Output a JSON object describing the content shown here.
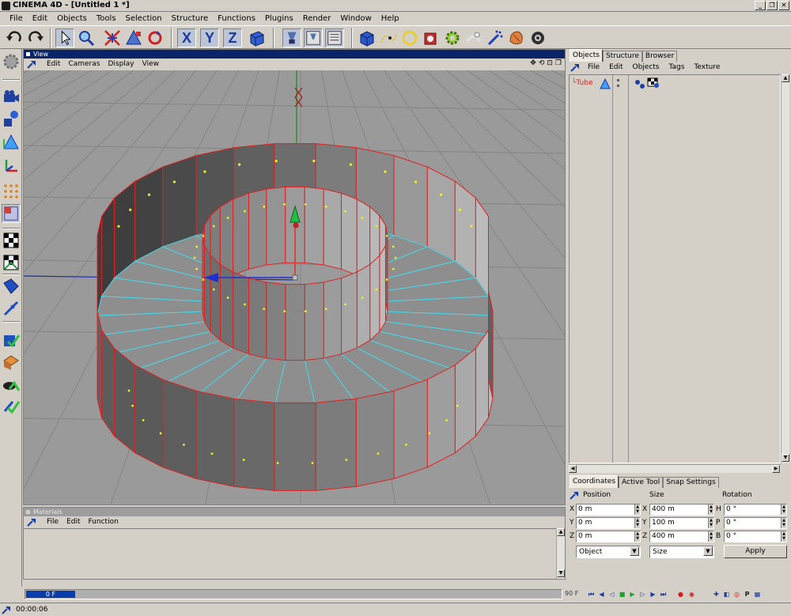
{
  "window": {
    "title": "CINEMA 4D - [Untitled 1 *]"
  },
  "menu": [
    "File",
    "Edit",
    "Objects",
    "Tools",
    "Selection",
    "Structure",
    "Functions",
    "Plugins",
    "Render",
    "Window",
    "Help"
  ],
  "toolbar": {
    "x_axis": "X",
    "y_axis": "Y",
    "z_axis": "Z"
  },
  "view": {
    "title": "View",
    "menu": [
      "Edit",
      "Cameras",
      "Display",
      "View"
    ],
    "nav_glyphs": [
      "✥",
      "⟲",
      "⊡",
      "❐"
    ]
  },
  "materials": {
    "title": "Materials",
    "menu": [
      "File",
      "Edit",
      "Function"
    ]
  },
  "timeline": {
    "current_frame": "0 F",
    "end_frame": "90 F"
  },
  "status": {
    "time": "00:00:06"
  },
  "object_manager": {
    "tabs": [
      "Objects",
      "Structure",
      "Browser"
    ],
    "active_tab": "Objects",
    "menu": [
      "File",
      "Edit",
      "Objects",
      "Tags",
      "Texture"
    ],
    "objects": [
      {
        "name": "Tube",
        "color": "#e02020"
      }
    ]
  },
  "coordinates": {
    "tabs": [
      "Coordinates",
      "Active Tool",
      "Snap Settings"
    ],
    "active_tab": "Coordinates",
    "headers": {
      "position": "Position",
      "size": "Size",
      "rotation": "Rotation"
    },
    "rows": [
      {
        "pos_label": "X",
        "pos": "0 m",
        "size_label": "X",
        "size": "400 m",
        "rot_label": "H",
        "rot": "0 °"
      },
      {
        "pos_label": "Y",
        "pos": "0 m",
        "size_label": "Y",
        "size": "100 m",
        "rot_label": "P",
        "rot": "0 °"
      },
      {
        "pos_label": "Z",
        "pos": "0 m",
        "size_label": "Z",
        "size": "400 m",
        "rot_label": "B",
        "rot": "0 °"
      }
    ],
    "mode_select": "Object",
    "size_select": "Size",
    "apply_label": "Apply"
  },
  "colors": {
    "viewport_bg": "#9a9a9a",
    "edge": "#e02020",
    "inner_edge": "#44d8e8",
    "normal": "#f0f020",
    "active_panel": "#0a246a"
  }
}
